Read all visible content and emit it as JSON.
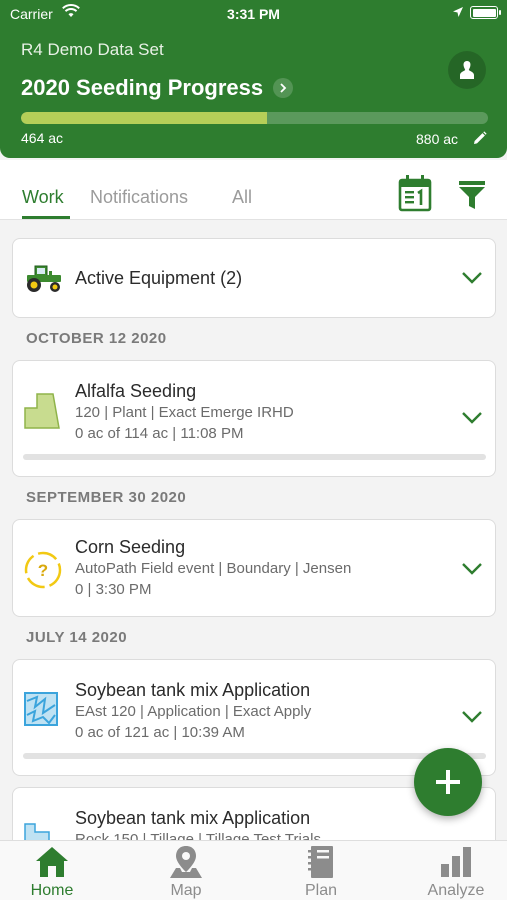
{
  "status_bar": {
    "carrier": "Carrier",
    "time": "3:31 PM"
  },
  "header": {
    "dataset": "R4 Demo Data Set",
    "title": "2020 Seeding Progress",
    "progress_left": "464 ac",
    "progress_right": "880 ac",
    "progress_fraction": 0.527
  },
  "tabs": [
    {
      "label": "Work",
      "active": true
    },
    {
      "label": "Notifications",
      "active": false
    },
    {
      "label": "All",
      "active": false
    }
  ],
  "feed": {
    "active_equipment": "Active Equipment (2)",
    "groups": [
      {
        "date": "OCTOBER 12 2020",
        "title": "Alfalfa Seeding",
        "line1": "120 | Plant | Exact Emerge IRHD",
        "line2": "0 ac of 114 ac | 11:08 PM",
        "icon": "field-boundary-icon"
      },
      {
        "date": "SEPTEMBER 30 2020",
        "title": "Corn Seeding",
        "line1": "AutoPath Field event | Boundary | Jensen",
        "line2": "0  | 3:30 PM",
        "icon": "question-icon"
      },
      {
        "date": "JULY 14 2020",
        "title": "Soybean tank mix Application",
        "line1": "EAst 120 | Application | Exact Apply",
        "line2": "0 ac of 121 ac | 10:39 AM",
        "icon": "application-map-icon"
      }
    ],
    "partial_card": {
      "title": "Soybean tank mix Application",
      "line1": "Rock 150 | Tillage | Tillage Test Trials"
    }
  },
  "bottom_nav": [
    {
      "label": "Home",
      "icon": "home-icon",
      "active": true
    },
    {
      "label": "Map",
      "icon": "map-pin-icon",
      "active": false
    },
    {
      "label": "Plan",
      "icon": "notebook-icon",
      "active": false
    },
    {
      "label": "Analyze",
      "icon": "bar-chart-icon",
      "active": false
    }
  ],
  "colors": {
    "brand_green": "#2e7d2f",
    "progress_fill": "#b5cf58",
    "field_green": "#c8dc8f",
    "warning_yellow": "#f2c913",
    "application_blue": "#3ba4dc"
  }
}
